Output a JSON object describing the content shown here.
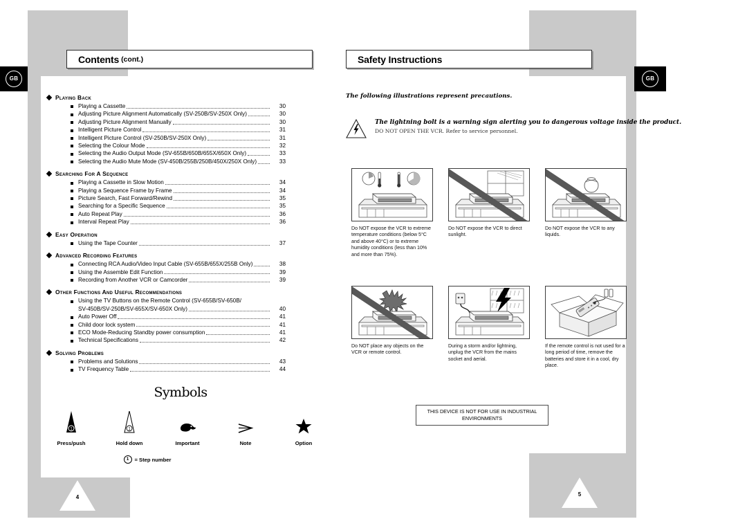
{
  "badges": {
    "left": "GB",
    "right": "GB"
  },
  "left_page": {
    "header": {
      "main": "Contents",
      "sub": "(cont.)"
    },
    "page_number": "4",
    "toc": [
      {
        "title": "Playing Back",
        "entries": [
          {
            "text": "Playing a Cassette",
            "page": "30"
          },
          {
            "text": "Adjusting Picture Alignment Automatically (SV-250B/SV-250X Only)",
            "page": "30"
          },
          {
            "text": "Adjusting Picture Alignment Manually",
            "page": "30"
          },
          {
            "text": "Intelligent Picture Control",
            "page": "31"
          },
          {
            "text": "Intelligent Picture Control (SV-250B/SV-250X Only)",
            "page": "31"
          },
          {
            "text": "Selecting the Colour Mode",
            "page": "32"
          },
          {
            "text": "Selecting the Audio Output Mode (SV-655B/650B/655X/650X Only)",
            "page": "33"
          },
          {
            "text": "Selecting the Audio Mute Mode (SV-450B/255B/250B/450X/250X Only)",
            "page": "33"
          }
        ]
      },
      {
        "title": "Searching for a Sequence",
        "entries": [
          {
            "text": "Playing a Cassette in Slow Motion",
            "page": "34"
          },
          {
            "text": "Playing a Sequence Frame by Frame",
            "page": "34"
          },
          {
            "text": "Picture Search, Fast Forward/Rewind",
            "page": "35"
          },
          {
            "text": "Searching for a Specific Sequence",
            "page": "35"
          },
          {
            "text": "Auto Repeat Play",
            "page": "36"
          },
          {
            "text": "Interval Repeat Play",
            "page": "36"
          }
        ]
      },
      {
        "title": "Easy operation",
        "entries": [
          {
            "text": "Using the Tape Counter",
            "page": "37"
          }
        ]
      },
      {
        "title": "Advanced Recording Features",
        "entries": [
          {
            "text": "Connecting RCA Audio/Video Input Cable (SV-655B/655X/255B Only)",
            "page": "38"
          },
          {
            "text": "Using the Assemble Edit Function",
            "page": "39"
          },
          {
            "text": "Recording from Another VCR or Camcorder",
            "page": "39"
          }
        ]
      },
      {
        "title": "Other Functions and Useful Recommendations",
        "entries": [
          {
            "text": "Using the TV Buttons on the Remote Control (SV-655B/SV-650B/",
            "page": "",
            "nodots": true
          },
          {
            "text": "SV-450B/SV-250B/SV-655X/SV-650X Only)",
            "page": "40",
            "continuation": true
          },
          {
            "text": "Auto Power Off",
            "page": "41"
          },
          {
            "text": "Child door lock system",
            "page": "41"
          },
          {
            "text": "ECO Mode-Reducing Standby power consumption",
            "page": "41"
          },
          {
            "text": "Technical Specifications",
            "page": "42"
          }
        ]
      },
      {
        "title": "Solving Problems",
        "entries": [
          {
            "text": "Problems and Solutions",
            "page": "43"
          },
          {
            "text": "TV Frequency Table",
            "page": "44"
          }
        ]
      }
    ],
    "symbols": {
      "title": "Symbols",
      "items": [
        {
          "label": "Press/push",
          "icon": "filled-cone-icon"
        },
        {
          "label": "Hold down",
          "icon": "outline-cone-icon"
        },
        {
          "label": "Important",
          "icon": "pointing-hand-icon"
        },
        {
          "label": "Note",
          "icon": "arrow-head-icon"
        },
        {
          "label": "Option",
          "icon": "star-icon"
        }
      ],
      "step_note": "= Step number",
      "step_digit": "1"
    }
  },
  "right_page": {
    "header": {
      "main": "Safety Instructions",
      "sub": ""
    },
    "page_number": "5",
    "intro": "The following illustrations represent precautions.",
    "bolt_warning": {
      "strong": "The lightning bolt is a warning sign alerting you to dangerous voltage inside the product.",
      "sub": "DO NOT OPEN THE VCR. Refer to service personnel."
    },
    "illustrations": [
      {
        "icon": "vcr-temperature-icon",
        "slash": false,
        "caption": "Do NOT expose the VCR to extreme temperature conditions (below 5°C and above 40°C) or to extreme humidity conditions (less than 10% and more than 75%)."
      },
      {
        "icon": "vcr-sunlight-icon",
        "slash": true,
        "caption": "Do NOT expose the VCR to direct sunlight."
      },
      {
        "icon": "vcr-liquids-icon",
        "slash": true,
        "caption": "Do NOT expose the VCR to any liquids."
      },
      {
        "icon": "vcr-objects-icon",
        "slash": true,
        "caption": "Do NOT place any objects on the VCR or remote control."
      },
      {
        "icon": "vcr-storm-icon",
        "slash": false,
        "caption": "During a storm and/or lightning, unplug the VCR from the mains socket and aerial."
      },
      {
        "icon": "remote-battery-box-icon",
        "slash": false,
        "caption": "If the remote control is not used for a long period of time, remove the batteries and store it in a cool, dry place."
      }
    ],
    "notice": "THIS DEVICE IS NOT FOR USE IN INDUSTRIAL ENVIRONMENTS"
  }
}
